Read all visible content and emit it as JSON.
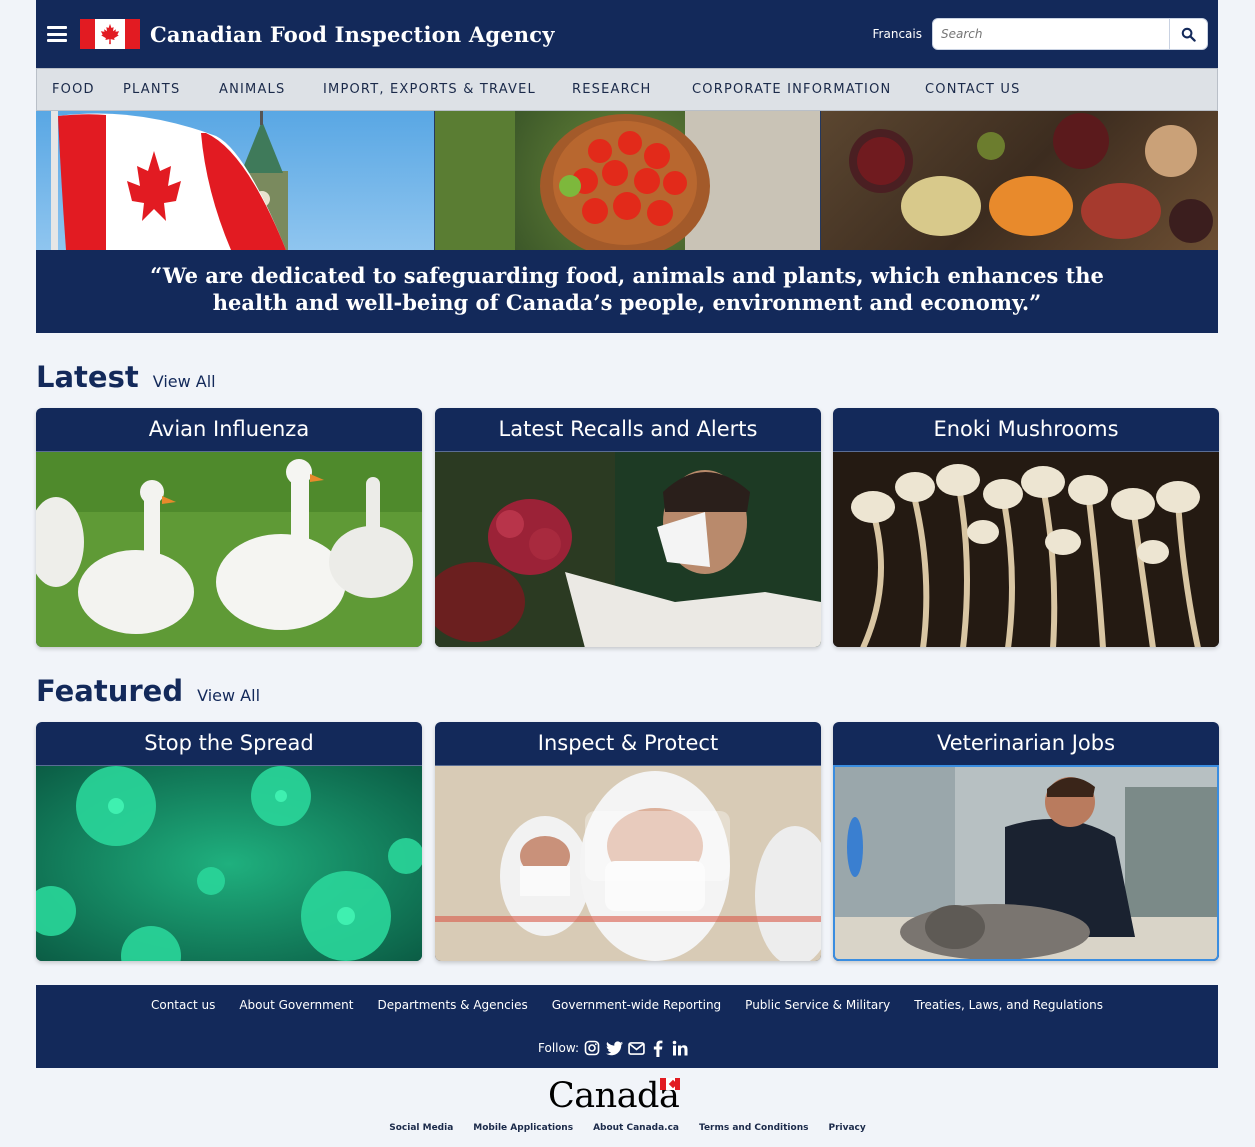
{
  "header": {
    "agency_name": "Canadian Food Inspection Agency",
    "language_link": "Francais",
    "search_placeholder": "Search"
  },
  "nav": {
    "items": [
      "FOOD",
      "PLANTS",
      "ANIMALS",
      "IMPORT, EXPORTS & TRAVEL",
      "RESEARCH",
      "CORPORATE INFORMATION",
      "CONTACT US"
    ]
  },
  "hero": {
    "quote_line1": "“We are dedicated to safeguarding food, animals and plants, which enhances the",
    "quote_line2": "health and well-being of Canada’s people, environment and economy.”"
  },
  "latest": {
    "title": "Latest",
    "view_all": "View All",
    "cards": [
      {
        "title": "Avian Influenza"
      },
      {
        "title": "Latest Recalls and Alerts"
      },
      {
        "title": "Enoki Mushrooms"
      }
    ]
  },
  "featured": {
    "title": "Featured",
    "view_all": "View All",
    "cards": [
      {
        "title": "Stop the Spread"
      },
      {
        "title": "Inspect & Protect"
      },
      {
        "title": "Veterinarian Jobs"
      }
    ]
  },
  "footer": {
    "links": [
      "Contact us",
      "About Government",
      "Departments & Agencies",
      "Government-wide Reporting",
      "Public Service & Military",
      "Treaties, Laws, and Regulations"
    ],
    "follow_label": "Follow:",
    "social_icons": [
      "instagram-icon",
      "twitter-icon",
      "email-icon",
      "facebook-icon",
      "linkedin-icon"
    ],
    "wordmark": "Canada",
    "sub_links": [
      "Social Media",
      "Mobile Applications",
      "About Canada.ca",
      "Terms and Conditions",
      "Privacy"
    ]
  },
  "colors": {
    "navy": "#13295a",
    "nav_bg": "#dde1e6",
    "page_bg": "#f1f4f9",
    "flag_red": "#e21b22",
    "selected_border": "#3a8de0"
  }
}
